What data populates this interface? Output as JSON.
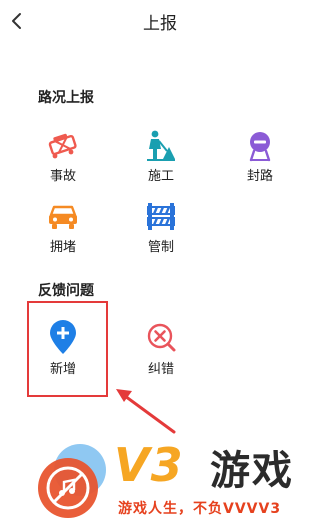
{
  "header": {
    "title": "上报",
    "back_icon": "chevron-left-icon"
  },
  "sections": {
    "road_report": {
      "title": "路况上报",
      "items": [
        {
          "label": "事故",
          "icon": "accident-icon",
          "color": "#ef5a4f"
        },
        {
          "label": "施工",
          "icon": "construction-icon",
          "color": "#1a9fb0"
        },
        {
          "label": "封路",
          "icon": "road-closed-icon",
          "color": "#8b5bd6"
        },
        {
          "label": "拥堵",
          "icon": "traffic-jam-icon",
          "color": "#f58a23"
        },
        {
          "label": "管制",
          "icon": "traffic-control-icon",
          "color": "#2a73d9"
        }
      ]
    },
    "feedback": {
      "title": "反馈问题",
      "items": [
        {
          "label": "新增",
          "icon": "add-location-icon",
          "color": "#1e7fe6"
        },
        {
          "label": "纠错",
          "icon": "error-correction-icon",
          "color": "#e9545b"
        }
      ]
    }
  },
  "annotation": {
    "highlight_color": "#e43a3a"
  },
  "watermark": {
    "brand": "V3",
    "brand_cn": "游戏",
    "slogan": "游戏人生，不负VVVV3",
    "colors": {
      "brand": "#f6a623",
      "slogan": "#e6411e"
    }
  }
}
